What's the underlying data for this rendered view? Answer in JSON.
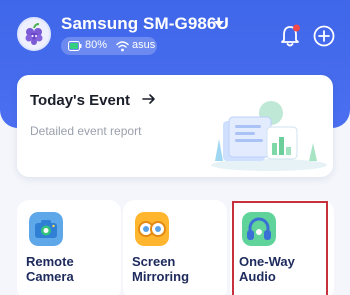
{
  "header": {
    "device_name": "Samsung SM-G986U",
    "battery": "80%",
    "wifi": "asus",
    "accent_color": "#4169ee",
    "icons": [
      "avatar",
      "caret-down-icon",
      "battery-icon",
      "wifi-icon",
      "bell-icon",
      "add-icon"
    ]
  },
  "event_card": {
    "title": "Today's Event",
    "subtitle": "Detailed event report"
  },
  "tiles": [
    {
      "line1": "Remote",
      "line2": "Camera",
      "icon": "camera-icon"
    },
    {
      "line1": "Screen",
      "line2": "Mirroring",
      "icon": "mirroring-icon"
    },
    {
      "line1": "One-Way",
      "line2": "Audio",
      "icon": "headphones-icon"
    }
  ]
}
